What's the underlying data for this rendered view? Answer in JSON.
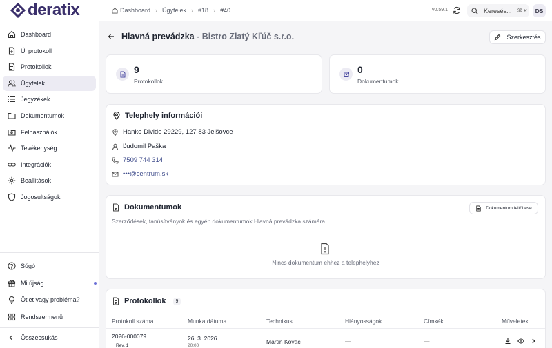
{
  "app": {
    "logo_text": "deratix",
    "version": "v0.59.1",
    "user_initials": "DS"
  },
  "breadcrumb": [
    {
      "label": "Dashboard"
    },
    {
      "label": "Ügyfelek"
    },
    {
      "label": "#18"
    },
    {
      "label": "#40"
    }
  ],
  "search": {
    "placeholder": "Keresés...",
    "shortcut": "⌘ K"
  },
  "sidebar": {
    "items": [
      {
        "label": "Dashboard",
        "icon": "home-icon"
      },
      {
        "label": "Új protokoll",
        "icon": "file-plus-icon"
      },
      {
        "label": "Protokollok",
        "icon": "file-text-icon"
      },
      {
        "label": "Ügyfelek",
        "icon": "users-icon",
        "active": true
      },
      {
        "label": "Jegyzékek",
        "icon": "list-icon"
      },
      {
        "label": "Dokumentumok",
        "icon": "folder-icon"
      },
      {
        "label": "Felhasználók",
        "icon": "user-folder-icon"
      },
      {
        "label": "Tevékenység",
        "icon": "activity-icon"
      },
      {
        "label": "Integrációk",
        "icon": "link-icon"
      },
      {
        "label": "Beállítások",
        "icon": "gear-icon"
      },
      {
        "label": "Jogosultságok",
        "icon": "shield-icon"
      }
    ],
    "bottom": [
      {
        "label": "Súgó",
        "icon": "help-icon"
      },
      {
        "label": "Mi újság",
        "icon": "gift-icon"
      },
      {
        "label": "Ötlet vagy probléma?",
        "icon": "lightbulb-icon"
      },
      {
        "label": "Rendszermenü",
        "icon": "grid-icon"
      }
    ],
    "collapse_label": "Összecsukás"
  },
  "page": {
    "title": "Hlavná prevádzka",
    "title_sep": " - ",
    "subtitle": "Bistro Zlatý Kľúč s.r.o.",
    "edit_label": "Szerkesztés"
  },
  "stats": [
    {
      "value": "9",
      "label": "Protokollok",
      "icon": "file-text-icon"
    },
    {
      "value": "0",
      "label": "Dokumentumok",
      "icon": "archive-icon"
    }
  ],
  "site_info": {
    "title": "Telephely információi",
    "address": "Hanko Divide 29229, 127 83 Jelšovce",
    "contact": "Ľudomil Paška",
    "phone": "7509 744 314",
    "email": "•••@centrum.sk"
  },
  "documents": {
    "title": "Dokumentumok",
    "upload_label": "Dokumentum feltöltése",
    "description": "Szerződések, tanúsítványok és egyéb dokumentumok Hlavná prevádzka számára",
    "empty_text": "Nincs dokumentum ehhez a telephelyhez"
  },
  "protocols": {
    "title": "Protokollok",
    "count": "9",
    "columns": [
      "Protokoll száma",
      "Munka dátuma",
      "Technikus",
      "Hiányosságok",
      "Címkék",
      "Műveletek"
    ],
    "rows": [
      {
        "number": "2026-000079",
        "rev": "Rev. 1",
        "date": "26. 3. 2026",
        "time": "20:00",
        "technician": "Martin Kováč",
        "defects": "—",
        "tags": "—"
      }
    ]
  }
}
